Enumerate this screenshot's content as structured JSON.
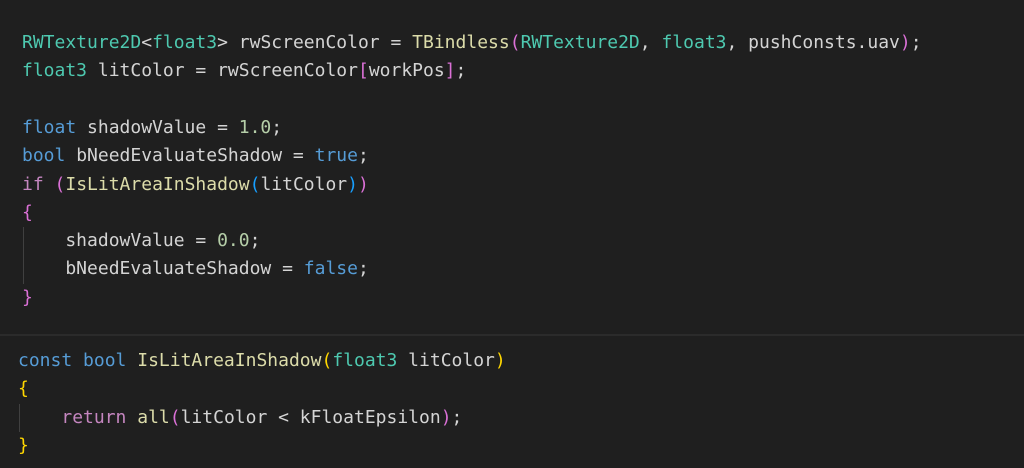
{
  "colors": {
    "background": "#1f1f1f",
    "type": "#4ec9b0",
    "keyword": "#569cd6",
    "control": "#c586c0",
    "variable": "#d4d4d4",
    "function": "#dcdcaa",
    "number": "#b5cea8",
    "bracket_gold": "#ffd700",
    "bracket_purple": "#da70d6",
    "bracket_blue": "#179fff",
    "indent_guide": "#404040"
  },
  "snippets": [
    {
      "name": "caller-snippet",
      "lines": [
        [
          [
            "RWTexture2D",
            "type"
          ],
          [
            "<",
            "variable"
          ],
          [
            "float3",
            "type"
          ],
          [
            "> rwScreenColor = ",
            "variable"
          ],
          [
            "TBindless",
            "function"
          ],
          [
            "(",
            "bracket_purple"
          ],
          [
            "RWTexture2D",
            "type"
          ],
          [
            ", ",
            "variable"
          ],
          [
            "float3",
            "type"
          ],
          [
            ", pushConsts.uav",
            "variable"
          ],
          [
            ")",
            "bracket_purple"
          ],
          [
            ";",
            "variable"
          ]
        ],
        [
          [
            "float3",
            "type"
          ],
          [
            " litColor = rwScreenColor",
            "variable"
          ],
          [
            "[",
            "bracket_purple"
          ],
          [
            "workPos",
            "variable"
          ],
          [
            "]",
            "bracket_purple"
          ],
          [
            ";",
            "variable"
          ]
        ],
        [],
        [
          [
            "float",
            "keyword"
          ],
          [
            " shadowValue = ",
            "variable"
          ],
          [
            "1.0",
            "number"
          ],
          [
            ";",
            "variable"
          ]
        ],
        [
          [
            "bool",
            "keyword"
          ],
          [
            " bNeedEvaluateShadow = ",
            "variable"
          ],
          [
            "true",
            "keyword"
          ],
          [
            ";",
            "variable"
          ]
        ],
        [
          [
            "if",
            "control"
          ],
          [
            " ",
            "variable"
          ],
          [
            "(",
            "bracket_purple"
          ],
          [
            "IsLitAreaInShadow",
            "function"
          ],
          [
            "(",
            "bracket_blue"
          ],
          [
            "litColor",
            "variable"
          ],
          [
            ")",
            "bracket_blue"
          ],
          [
            ")",
            "bracket_purple"
          ]
        ],
        [
          [
            "{",
            "bracket_purple"
          ]
        ],
        [
          [
            "    shadowValue = ",
            "variable"
          ],
          [
            "0.0",
            "number"
          ],
          [
            ";",
            "variable"
          ]
        ],
        [
          [
            "    bNeedEvaluateShadow = ",
            "variable"
          ],
          [
            "false",
            "keyword"
          ],
          [
            ";",
            "variable"
          ]
        ],
        [
          [
            "}",
            "bracket_purple"
          ]
        ]
      ]
    },
    {
      "name": "function-definition-snippet",
      "lines": [
        [
          [
            "const",
            "keyword"
          ],
          [
            " ",
            "variable"
          ],
          [
            "bool",
            "keyword"
          ],
          [
            " ",
            "variable"
          ],
          [
            "IsLitAreaInShadow",
            "function"
          ],
          [
            "(",
            "bracket_gold"
          ],
          [
            "float3",
            "type"
          ],
          [
            " litColor",
            "variable"
          ],
          [
            ")",
            "bracket_gold"
          ]
        ],
        [
          [
            "{",
            "bracket_gold"
          ]
        ],
        [
          [
            "    ",
            "variable"
          ],
          [
            "return",
            "control"
          ],
          [
            " ",
            "variable"
          ],
          [
            "all",
            "function"
          ],
          [
            "(",
            "bracket_purple"
          ],
          [
            "litColor < kFloatEpsilon",
            "variable"
          ],
          [
            ")",
            "bracket_purple"
          ],
          [
            ";",
            "variable"
          ]
        ],
        [
          [
            "}",
            "bracket_gold"
          ]
        ]
      ]
    }
  ]
}
